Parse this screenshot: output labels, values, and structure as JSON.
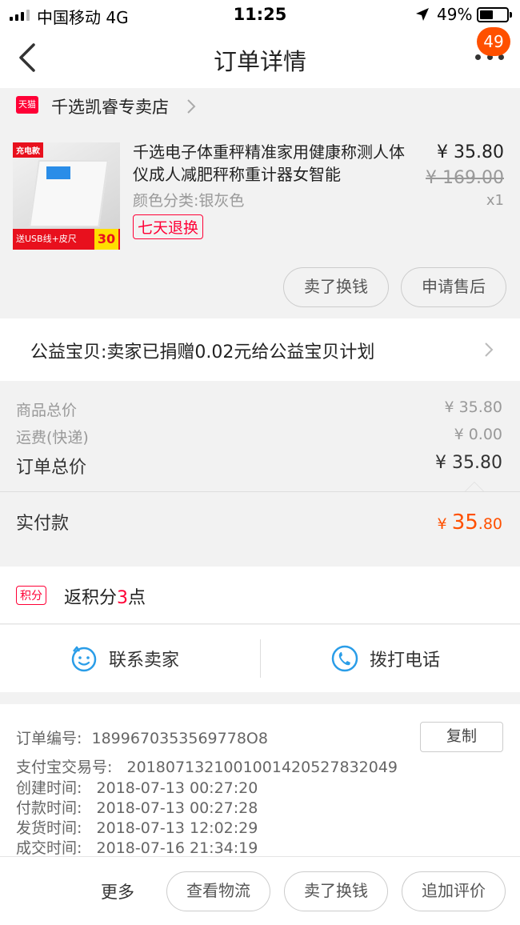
{
  "status_bar": {
    "carrier": "中国移动  4G",
    "time": "11:25",
    "battery": "49%"
  },
  "nav": {
    "title": "订单详情",
    "badge": "49"
  },
  "store": {
    "platform_logo": "天猫",
    "name": "千选凯睿专卖店"
  },
  "product": {
    "thumb_tag": "充电款",
    "thumb_banner": "送USB线+皮尺",
    "thumb_price": "30",
    "title": "千选电子体重秤精准家用健康称测人体仪成人减肥秤称重计器女智能",
    "sku": "颜色分类:银灰色",
    "return_tag": "七天退换",
    "price": "¥ 35.80",
    "original_price": "¥ 169.00",
    "quantity": "x1",
    "resell_button": "卖了换钱",
    "after_sale_button": "申请售后"
  },
  "charity": {
    "text": "公益宝贝:卖家已捐赠0.02元给公益宝贝计划"
  },
  "summary": {
    "goods_total_label": "商品总价",
    "goods_total_value": "¥ 35.80",
    "shipping_label": "运费(快递)",
    "shipping_value": "¥ 0.00",
    "order_total_label": "订单总价",
    "order_total_value": "¥ 35.80",
    "paid_label": "实付款",
    "paid_currency": "¥",
    "paid_integer": "35",
    "paid_decimal": ".80"
  },
  "points": {
    "badge": "积分",
    "text_prefix": "返积分",
    "count": "3",
    "text_suffix": "点"
  },
  "contact": {
    "seller_label": "联系卖家",
    "phone_label": "拨打电话"
  },
  "order_info": {
    "order_no_label": "订单编号:",
    "order_no": "1899670353569778O8",
    "copy_button": "复制",
    "alipay_label": "支付宝交易号:",
    "alipay_no": "2018071321001001420527832049",
    "created_label": "创建时间:",
    "created": "2018-07-13 00:27:20",
    "paid_label": "付款时间:",
    "paid": "2018-07-13 00:27:28",
    "shipped_label": "发货时间:",
    "shipped": "2018-07-13 12:02:29",
    "completed_label": "成交时间:",
    "completed": "2018-07-16 21:34:19"
  },
  "bottom_bar": {
    "more": "更多",
    "logistics_button": "查看物流",
    "resell_button": "卖了换钱",
    "review_button": "追加评价"
  },
  "colors": {
    "accent": "#ff5000",
    "tmall_red": "#ff0036",
    "contact_blue": "#2a9de8"
  }
}
